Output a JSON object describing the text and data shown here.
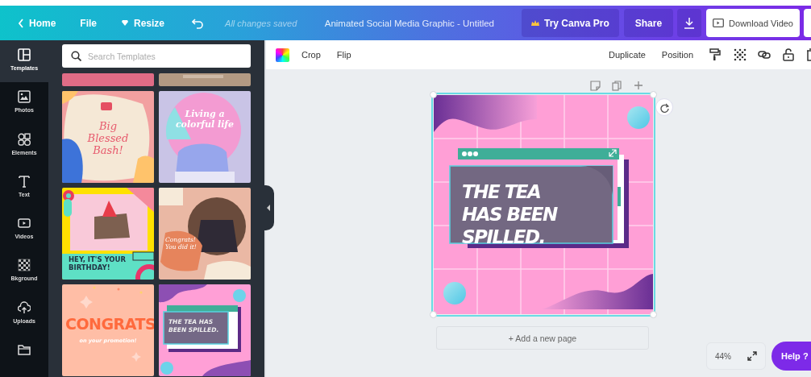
{
  "header": {
    "home": "Home",
    "file": "File",
    "resize": "Resize",
    "save_status": "All changes saved",
    "title": "Animated Social Media Graphic - Untitled",
    "pro_button": "Try Canva Pro",
    "share_button": "Share",
    "download_button": "Download Video"
  },
  "sidebar": {
    "items": [
      {
        "label": "Templates",
        "selected": true
      },
      {
        "label": "Photos",
        "selected": false
      },
      {
        "label": "Elements",
        "selected": false
      },
      {
        "label": "Text",
        "selected": false
      },
      {
        "label": "Videos",
        "selected": false
      },
      {
        "label": "Bkground",
        "selected": false
      },
      {
        "label": "Uploads",
        "selected": false
      },
      {
        "selected": false
      }
    ]
  },
  "template_panel": {
    "search": {
      "placeholder": "Search Templates"
    },
    "templates": [
      {
        "kind": "pink-top"
      },
      {
        "kind": "beige-top"
      },
      {
        "kind": "blobs",
        "texts": [
          "Big Blessed Bash!"
        ]
      },
      {
        "kind": "gradient",
        "texts": [
          "Living a colorful life"
        ]
      },
      {
        "kind": "party",
        "texts": [
          "HEY, IT'S YOUR BIRTHDAY!"
        ]
      },
      {
        "kind": "collage",
        "texts": [
          "Congrats! You did it!"
        ]
      },
      {
        "kind": "confetti",
        "texts": [
          "CONGRATS",
          "on your promotion!"
        ]
      },
      {
        "kind": "retro",
        "texts": [
          "THE TEA HAS BEEN SPILLED."
        ]
      }
    ]
  },
  "toolbar": {
    "left": [
      "Crop",
      "Flip"
    ],
    "right": [
      "Duplicate",
      "Position"
    ]
  },
  "design": {
    "headline": "THE TEA HAS BEEN SPILLED."
  },
  "add_page": "+ Add a new page",
  "zoom": "44%",
  "help": "Help ?"
}
